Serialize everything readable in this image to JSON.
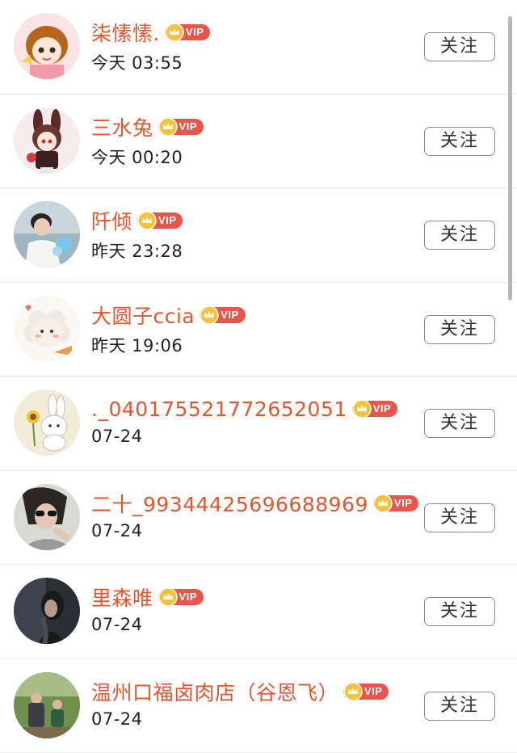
{
  "follow_label": "关注",
  "vip_label": "VIP",
  "accent_color": "#e4552d",
  "rows": [
    {
      "name": "柒愫愫.",
      "time": "今天 03:55",
      "avatar_icon": "anime-girl-avatar"
    },
    {
      "name": "三水兔",
      "time": "今天 00:20",
      "avatar_icon": "bunny-girl-avatar"
    },
    {
      "name": "阡倾",
      "time": "昨天 23:28",
      "avatar_icon": "boy-photo-avatar"
    },
    {
      "name": "大圆子ccia",
      "time": "昨天 19:06",
      "avatar_icon": "sheep-avatar"
    },
    {
      "name": "._040175521772652051",
      "time": "07-24",
      "avatar_icon": "rabbit-sunflower-avatar"
    },
    {
      "name": "二十_99344425696688969",
      "time": "07-24",
      "avatar_icon": "sunglasses-girl-avatar"
    },
    {
      "name": "里森唯",
      "time": "07-24",
      "avatar_icon": "dark-portrait-avatar"
    },
    {
      "name": "温州口福卤肉店（谷恩飞）",
      "time": "07-24",
      "avatar_icon": "outdoor-photo-avatar"
    }
  ]
}
